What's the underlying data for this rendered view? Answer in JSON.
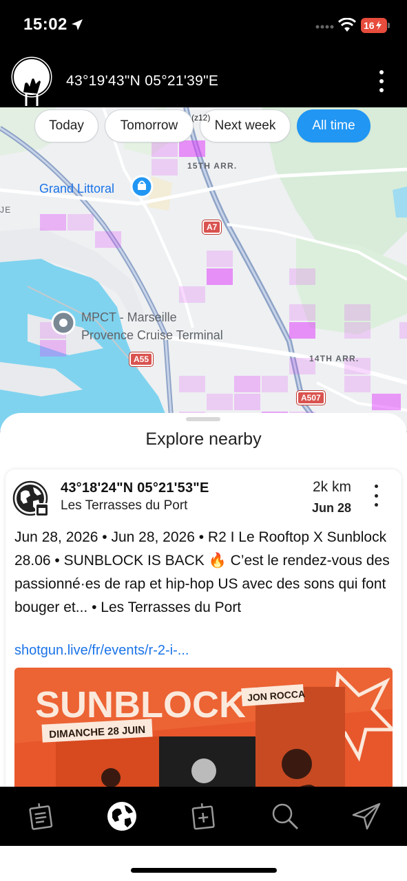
{
  "status_bar": {
    "time": "15:02",
    "battery": "16"
  },
  "header": {
    "coords": "43°19'43\"N 05°21'39\"E"
  },
  "map": {
    "filters": [
      {
        "label": "Today",
        "active": false
      },
      {
        "label": "Tomorrow",
        "active": false
      },
      {
        "label": "Next week",
        "active": false
      },
      {
        "label": "All time",
        "active": true
      }
    ],
    "zoom_label": "(z12)",
    "labels": {
      "district_15": "15TH ARR.",
      "district_14": "14TH ARR.",
      "poi_grand_littoral": "Grand Littoral",
      "poi_mpct_line1": "MPCT - Marseille",
      "poi_mpct_line2": "Provence Cruise Terminal",
      "edge_label": "JE"
    },
    "roads": {
      "a7": "A7",
      "a55": "A55",
      "a507": "A507"
    }
  },
  "sheet": {
    "title": "Explore nearby",
    "card": {
      "coords": "43°18'24\"N 05°21'53\"E",
      "place": "Les Terrasses du Port",
      "distance": "2k km",
      "date": "Jun 28",
      "description": "Jun 28, 2026 • Jun 28, 2026 • R2 I Le Rooftop X Sunblock 28.06 • SUNBLOCK IS BACK 🔥 C’est le rendez-vous des passionné·es de rap et hip-hop US avec des sons qui font bouger et... • Les Terrasses du Port",
      "link": "shotgun.live/fr/events/r-2-i-...",
      "poster": {
        "title": "SUNBLOCK",
        "date_banner": "DIMANCHE 28 JUIN",
        "artist": "JON ROCCA"
      }
    }
  },
  "tabs": [
    {
      "icon": "notes-icon"
    },
    {
      "icon": "globe-icon",
      "active": true
    },
    {
      "icon": "add-note-icon"
    },
    {
      "icon": "search-icon"
    },
    {
      "icon": "send-icon"
    }
  ]
}
